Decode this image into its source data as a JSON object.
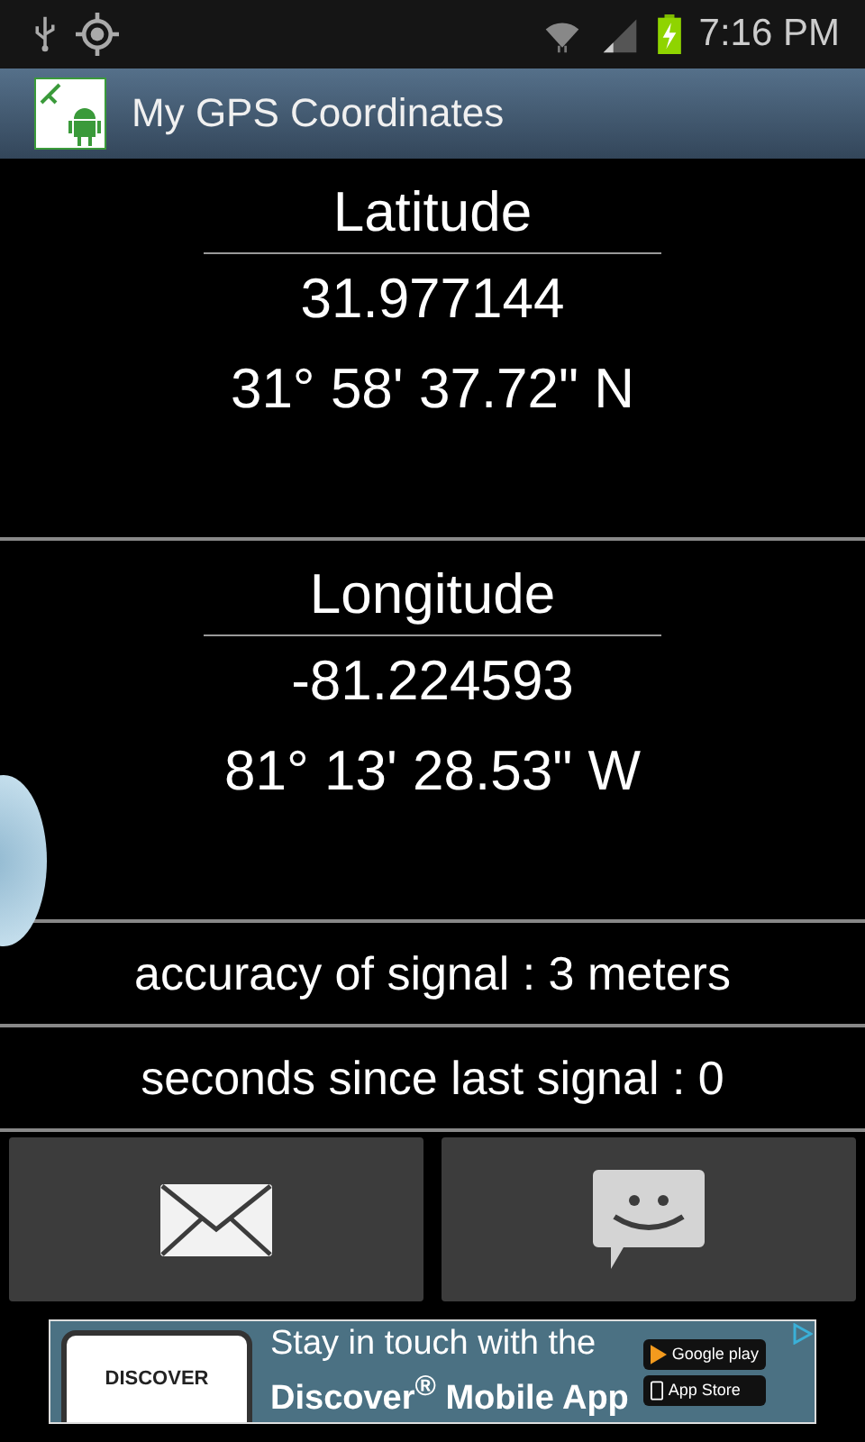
{
  "status_bar": {
    "time": "7:16 PM"
  },
  "app_bar": {
    "title": "My GPS Coordinates"
  },
  "coordinates": [
    {
      "heading": "Latitude",
      "decimal": "31.977144",
      "dms": "31° 58' 37.72\" N"
    },
    {
      "heading": "Longitude",
      "decimal": "-81.224593",
      "dms": "81° 13' 28.53\" W"
    }
  ],
  "info_lines": [
    "accuracy of signal : 3 meters",
    "seconds since last signal : 0"
  ],
  "ad": {
    "brand": "DISCOVER",
    "line_1": "Stay in touch with the",
    "line_2": "Discover$^{®}$ Mobile App",
    "store_1": "Google play",
    "store_2": "App Store"
  }
}
